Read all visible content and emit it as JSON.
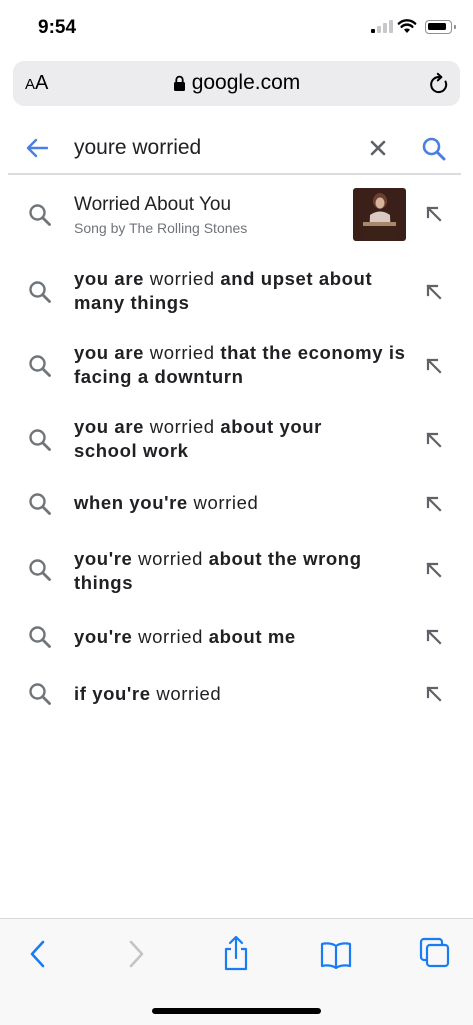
{
  "status": {
    "time": "9:54"
  },
  "address_bar": {
    "text_size_label": "AA",
    "url": "google.com"
  },
  "search": {
    "query": "youre worried"
  },
  "suggestions": [
    {
      "type": "entity",
      "title": "Worried About You",
      "subtitle": "Song by The Rolling Stones"
    },
    {
      "type": "query",
      "parts": [
        {
          "b": true,
          "t": "you are"
        },
        {
          "b": false,
          "t": " worried "
        },
        {
          "b": true,
          "t": "and upset about many things"
        }
      ]
    },
    {
      "type": "query",
      "parts": [
        {
          "b": true,
          "t": "you are"
        },
        {
          "b": false,
          "t": " worried "
        },
        {
          "b": true,
          "t": "that the economy is facing a downturn"
        }
      ]
    },
    {
      "type": "query",
      "parts": [
        {
          "b": true,
          "t": "you are"
        },
        {
          "b": false,
          "t": " worried "
        },
        {
          "b": true,
          "t": "about your school work"
        }
      ]
    },
    {
      "type": "query",
      "parts": [
        {
          "b": true,
          "t": "when you're"
        },
        {
          "b": false,
          "t": " worried"
        }
      ]
    },
    {
      "type": "query",
      "parts": [
        {
          "b": true,
          "t": "you're"
        },
        {
          "b": false,
          "t": " worried "
        },
        {
          "b": true,
          "t": "about the wrong things"
        }
      ]
    },
    {
      "type": "query",
      "parts": [
        {
          "b": true,
          "t": "you're"
        },
        {
          "b": false,
          "t": " worried "
        },
        {
          "b": true,
          "t": "about me"
        }
      ]
    },
    {
      "type": "query",
      "parts": [
        {
          "b": true,
          "t": "if you're"
        },
        {
          "b": false,
          "t": " worried"
        }
      ]
    }
  ],
  "colors": {
    "accent": "#4a80e4",
    "icon_gray": "#70757a",
    "toolbar_blue": "#1a7cf5"
  },
  "icons": {
    "back": "arrow-left-icon",
    "clear": "close-icon",
    "search": "search-icon",
    "suggestion": "search-icon",
    "fill": "arrow-up-left-icon",
    "toolbar": [
      "chevron-left-icon",
      "chevron-right-icon",
      "share-icon",
      "bookmarks-icon",
      "tabs-icon"
    ]
  }
}
